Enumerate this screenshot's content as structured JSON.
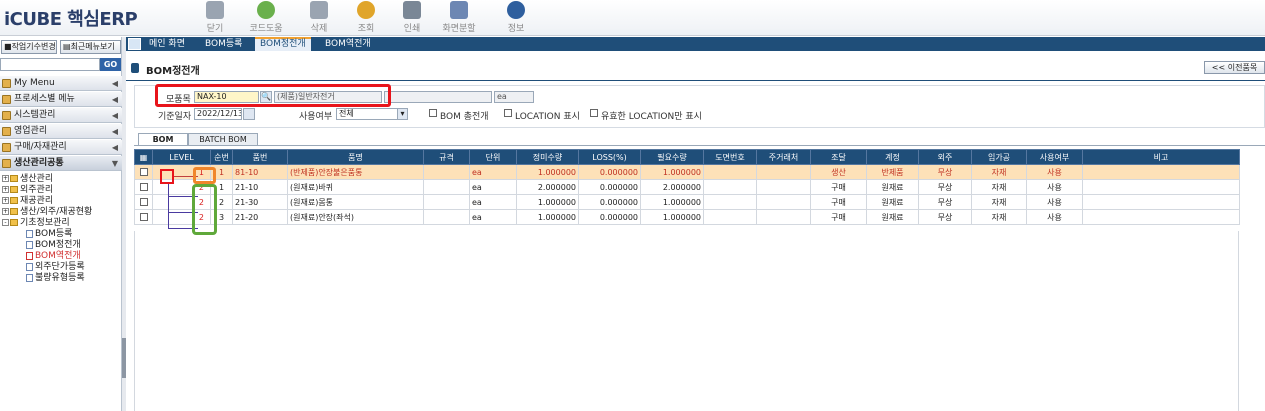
{
  "app": {
    "brand": "iCUBE 핵심ERP"
  },
  "toolbar": [
    {
      "label": "닫기",
      "icon": "close-icon",
      "color": "#9aa4b1"
    },
    {
      "label": "코드도움",
      "icon": "code-help-icon",
      "color": "#6ab04c"
    },
    {
      "label": "삭제",
      "icon": "delete-icon",
      "color": "#9aa4b1"
    },
    {
      "label": "조회",
      "icon": "search-icon",
      "color": "#e0a52a"
    },
    {
      "label": "인쇄",
      "icon": "print-icon",
      "color": "#7a8796"
    },
    {
      "label": "화면분할",
      "icon": "split-screen-icon",
      "color": "#6d87b3"
    },
    {
      "label": "정보",
      "icon": "info-icon",
      "color": "#2f5f9e"
    }
  ],
  "tabs": [
    {
      "label": "메인 화면",
      "active": false
    },
    {
      "label": "BOM등록",
      "active": false
    },
    {
      "label": "BOM정전개",
      "active": true
    },
    {
      "label": "BOM역전개",
      "active": false
    }
  ],
  "sidebar": {
    "btn_change": "작업기수변경",
    "btn_recent": "최근메뉴보기",
    "go_label": "GO",
    "menus": [
      "My Menu",
      "프로세스별 메뉴",
      "시스템관리",
      "영업관리",
      "구매/자재관리",
      "생산관리공통"
    ],
    "tree": [
      {
        "label": "생산관리",
        "type": "folder",
        "level": 0
      },
      {
        "label": "외주관리",
        "type": "folder",
        "level": 0
      },
      {
        "label": "재공관리",
        "type": "folder",
        "level": 0
      },
      {
        "label": "생산/외주/재공현황",
        "type": "folder",
        "level": 0
      },
      {
        "label": "기초정보관리",
        "type": "folder",
        "level": 0
      },
      {
        "label": "BOM등록",
        "type": "doc",
        "level": 1
      },
      {
        "label": "BOM정전개",
        "type": "doc",
        "level": 1
      },
      {
        "label": "BOM역전개",
        "type": "doc",
        "level": 1,
        "selected": true
      },
      {
        "label": "외주단가등록",
        "type": "doc",
        "level": 1
      },
      {
        "label": "불량유형등록",
        "type": "doc",
        "level": 1
      }
    ]
  },
  "page": {
    "title": "BOM정전개",
    "prev_button": "<< 이전품목"
  },
  "conditions": {
    "parent_label": "모품목",
    "parent_code": "NAX-10",
    "parent_name": "(제품)일반자전거",
    "unit": "ea",
    "base_date_label": "기준일자",
    "base_date": "2022/12/13",
    "use_label": "사용여부",
    "use_value": "전체",
    "chk_bom_all": "BOM 총전개",
    "chk_location": "LOCATION 표시",
    "chk_valid_location": "유효한 LOCATION만 표시"
  },
  "inner_tabs": [
    "BOM",
    "BATCH BOM"
  ],
  "grid": {
    "columns": [
      "",
      "LEVEL",
      "순번",
      "품번",
      "품명",
      "규격",
      "단위",
      "정미수량",
      "LOSS(%)",
      "필요수량",
      "도면번호",
      "주거래처",
      "조달",
      "계정",
      "외주",
      "임가공",
      "사용여부",
      "비고"
    ],
    "rows": [
      {
        "level": "1",
        "seq": "1",
        "code": "81-10",
        "name": "(반제품)안장불은품통",
        "spec": "",
        "unit": "ea",
        "net_qty": "1.000000",
        "loss": "0.000000",
        "req_qty": "1.000000",
        "drawing": "",
        "vendor": "",
        "procure": "생산",
        "account": "반제품",
        "outsource": "무상",
        "processing": "자재",
        "use": "사용",
        "note": "",
        "highlight": true
      },
      {
        "level": "2",
        "seq": "1",
        "code": "21-10",
        "name": "(원재료)바퀴",
        "spec": "",
        "unit": "ea",
        "net_qty": "2.000000",
        "loss": "0.000000",
        "req_qty": "2.000000",
        "drawing": "",
        "vendor": "",
        "procure": "구매",
        "account": "원재료",
        "outsource": "무상",
        "processing": "자재",
        "use": "사용",
        "note": ""
      },
      {
        "level": "2",
        "seq": "2",
        "code": "21-30",
        "name": "(원재료)몸통",
        "spec": "",
        "unit": "ea",
        "net_qty": "1.000000",
        "loss": "0.000000",
        "req_qty": "1.000000",
        "drawing": "",
        "vendor": "",
        "procure": "구매",
        "account": "원재료",
        "outsource": "무상",
        "processing": "자재",
        "use": "사용",
        "note": ""
      },
      {
        "level": "2",
        "seq": "3",
        "code": "21-20",
        "name": "(원재료)안장(좌석)",
        "spec": "",
        "unit": "ea",
        "net_qty": "1.000000",
        "loss": "0.000000",
        "req_qty": "1.000000",
        "drawing": "",
        "vendor": "",
        "procure": "구매",
        "account": "원재료",
        "outsource": "무상",
        "processing": "자재",
        "use": "사용",
        "note": ""
      }
    ]
  },
  "colors": {
    "header_navy": "#1f4e79",
    "highlight_row": "#fde1b8",
    "annot_red": "#e8141b",
    "annot_orange": "#f0862a",
    "annot_green": "#5fa83a"
  }
}
